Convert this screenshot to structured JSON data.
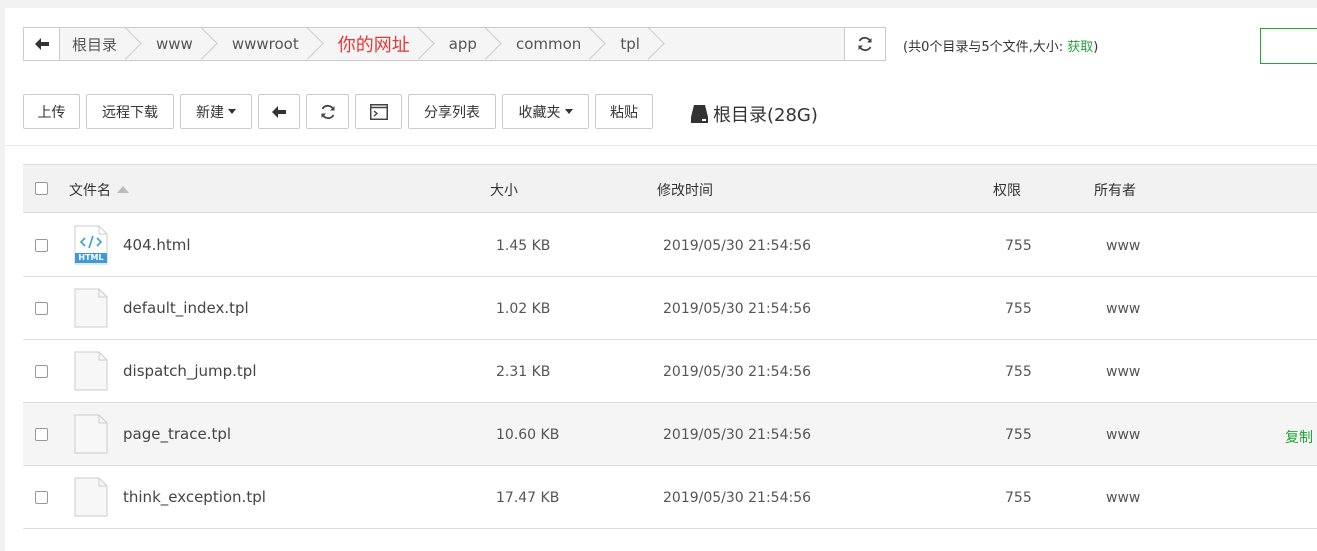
{
  "path": {
    "crumbs": [
      {
        "label": "根目录",
        "highlight": false
      },
      {
        "label": "www",
        "highlight": false
      },
      {
        "label": "wwwroot",
        "highlight": false
      },
      {
        "label": "你的网址",
        "highlight": true
      },
      {
        "label": "app",
        "highlight": false
      },
      {
        "label": "common",
        "highlight": false
      },
      {
        "label": "tpl",
        "highlight": false
      }
    ],
    "info_prefix": "(共0个目录与5个文件,大小: ",
    "info_link": "获取",
    "info_suffix": ")"
  },
  "toolbar": {
    "upload": "上传",
    "remote_download": "远程下载",
    "new": "新建",
    "share_list": "分享列表",
    "favorites": "收藏夹",
    "paste": "粘贴",
    "disk_label": "根目录(28G)"
  },
  "table": {
    "headers": {
      "name": "文件名",
      "size": "大小",
      "mtime": "修改时间",
      "perm": "权限",
      "owner": "所有者"
    },
    "rows": [
      {
        "name": "404.html",
        "size": "1.45 KB",
        "mtime": "2019/05/30 21:54:56",
        "perm": "755",
        "owner": "www",
        "icon": "html-file-icon",
        "op": ""
      },
      {
        "name": "default_index.tpl",
        "size": "1.02 KB",
        "mtime": "2019/05/30 21:54:56",
        "perm": "755",
        "owner": "www",
        "icon": "file-icon",
        "op": ""
      },
      {
        "name": "dispatch_jump.tpl",
        "size": "2.31 KB",
        "mtime": "2019/05/30 21:54:56",
        "perm": "755",
        "owner": "www",
        "icon": "file-icon",
        "op": ""
      },
      {
        "name": "page_trace.tpl",
        "size": "10.60 KB",
        "mtime": "2019/05/30 21:54:56",
        "perm": "755",
        "owner": "www",
        "icon": "file-icon",
        "op": "复制"
      },
      {
        "name": "think_exception.tpl",
        "size": "17.47 KB",
        "mtime": "2019/05/30 21:54:56",
        "perm": "755",
        "owner": "www",
        "icon": "file-icon",
        "op": ""
      }
    ],
    "html_badge": "HTML"
  },
  "colors": {
    "accent": "#20a53a",
    "highlight_crumb": "#e53935",
    "html_icon": "#3d9bd7"
  }
}
